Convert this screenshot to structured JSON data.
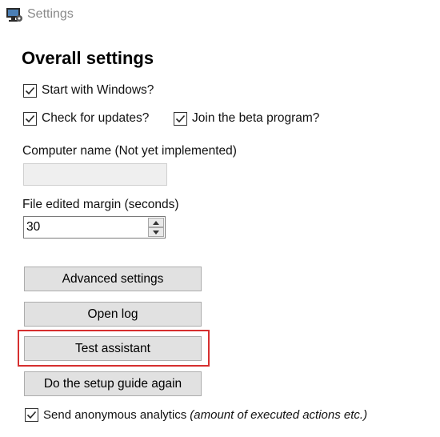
{
  "window": {
    "title": "Settings",
    "icon": "settings-app-icon"
  },
  "overall": {
    "heading": "Overall settings",
    "start_with_windows": {
      "label": "Start with Windows?",
      "checked": true
    },
    "check_updates": {
      "label": "Check for updates?",
      "checked": true
    },
    "join_beta": {
      "label": "Join the beta program?",
      "checked": true
    }
  },
  "computer_name": {
    "label": "Computer name (Not yet implemented)",
    "value": "",
    "enabled": false
  },
  "file_margin": {
    "label": "File edited margin (seconds)",
    "value": "30"
  },
  "buttons": {
    "advanced": "Advanced settings",
    "open_log": "Open log",
    "test_assistant": "Test assistant",
    "setup_guide": "Do the setup guide again"
  },
  "analytics": {
    "label": "Send anonymous analytics",
    "note": "(amount of executed actions etc.)",
    "checked": true
  },
  "colors": {
    "highlight": "#d62f2f",
    "button_bg": "#e1e1e1",
    "title_text": "#8a8a8a"
  }
}
